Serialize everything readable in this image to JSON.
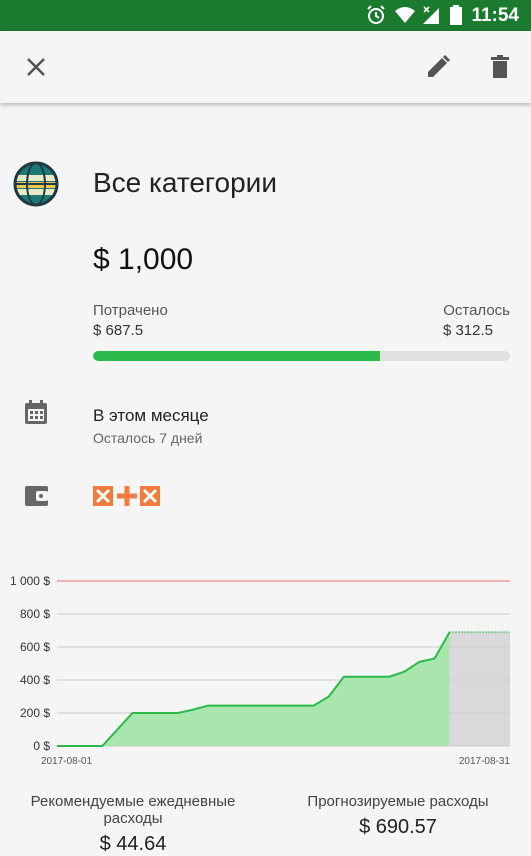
{
  "statusbar": {
    "time": "11:54"
  },
  "appbar": {
    "close_icon": "close-icon",
    "edit_icon": "pencil-icon",
    "delete_icon": "trash-icon"
  },
  "budget": {
    "category": "Все категории",
    "amount": "$ 1,000",
    "spent_label": "Потрачено",
    "spent_value": "$ 687.5",
    "left_label": "Осталось",
    "left_value": "$ 312.5",
    "progress_fraction": 0.6875,
    "progress_color": "#2bb94a"
  },
  "period": {
    "title": "В этом месяце",
    "subtitle": "Осталось 7 дней"
  },
  "chart_data": {
    "type": "area",
    "x": [
      "2017-08-01",
      "2017-08-02",
      "2017-08-03",
      "2017-08-04",
      "2017-08-05",
      "2017-08-06",
      "2017-08-07",
      "2017-08-08",
      "2017-08-09",
      "2017-08-10",
      "2017-08-11",
      "2017-08-12",
      "2017-08-13",
      "2017-08-14",
      "2017-08-15",
      "2017-08-16",
      "2017-08-17",
      "2017-08-18",
      "2017-08-19",
      "2017-08-20",
      "2017-08-21",
      "2017-08-22",
      "2017-08-23",
      "2017-08-24",
      "2017-08-25",
      "2017-08-26",
      "2017-08-27",
      "2017-08-28",
      "2017-08-29",
      "2017-08-30",
      "2017-08-31"
    ],
    "series": [
      {
        "values": [
          0,
          0,
          0,
          0,
          100,
          200,
          200,
          200,
          200,
          220,
          245,
          245,
          245,
          245,
          245,
          245,
          245,
          245,
          300,
          420,
          420,
          420,
          420,
          450,
          510,
          530,
          690,
          null,
          null,
          null,
          null
        ]
      },
      {
        "values": [
          null,
          null,
          null,
          null,
          null,
          null,
          null,
          null,
          null,
          null,
          null,
          null,
          null,
          null,
          null,
          null,
          null,
          null,
          null,
          null,
          null,
          null,
          null,
          null,
          null,
          null,
          690,
          690,
          690,
          690,
          690
        ]
      }
    ],
    "yticks": [
      "1 000 $",
      "800 $",
      "600 $",
      "400 $",
      "200 $",
      "0 $"
    ],
    "ytick_values": [
      1000,
      800,
      600,
      400,
      200,
      0
    ],
    "xtick_labels": [
      "2017-08-01",
      "2017-08-31"
    ],
    "budget_line": 1000,
    "ylim": [
      0,
      1000
    ],
    "colors": {
      "actual_fill": "#a8e6ae",
      "actual_line": "#2bb94a",
      "forecast_fill": "#d9d9d9",
      "budget_line": "#e57373",
      "grid": "#cccccc"
    }
  },
  "stats": {
    "daily_label": "Рекомендуемые ежедневные расходы",
    "daily_value": "$ 44.64",
    "forecast_label": "Прогнозируемые расходы",
    "forecast_value": "$ 690.57"
  }
}
